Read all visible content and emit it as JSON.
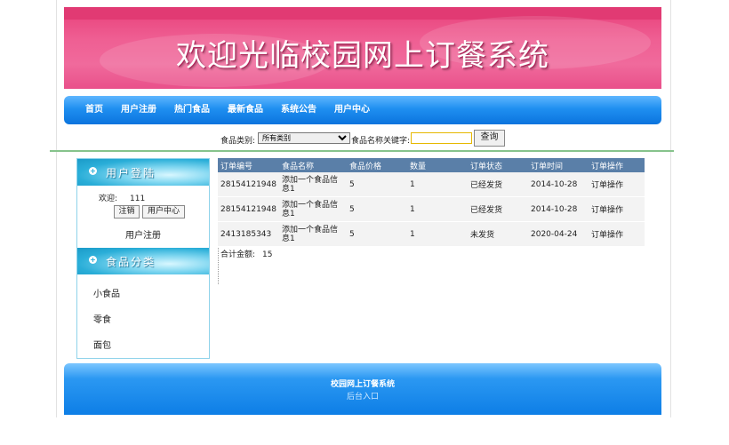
{
  "banner": {
    "title": "欢迎光临校园网上订餐系统"
  },
  "nav": {
    "items": [
      "首页",
      "用户注册",
      "热门食品",
      "最新食品",
      "系统公告",
      "用户中心"
    ]
  },
  "search": {
    "category_label": "食品类别:",
    "category_selected": "所有类别",
    "keyword_label": "食品名称关键字:",
    "keyword_value": "",
    "button_label": "查询"
  },
  "sidebar": {
    "login_title": "用户登陆",
    "welcome_label": "欢迎:",
    "welcome_user": "111",
    "logout_label": "注销",
    "user_center_label": "用户中心",
    "register_label": "用户注册",
    "category_title": "食品分类",
    "categories": [
      "小食品",
      "零食",
      "面包"
    ]
  },
  "orders": {
    "headers": [
      "订单编号",
      "食品名称",
      "食品价格",
      "数量",
      "订单状态",
      "订单时间",
      "订单操作"
    ],
    "rows": [
      [
        "28154121948",
        "添加一个食品信息1",
        "5",
        "1",
        "已经发货",
        "2014-10-28",
        "订单操作"
      ],
      [
        "28154121948",
        "添加一个食品信息1",
        "5",
        "1",
        "已经发货",
        "2014-10-28",
        "订单操作"
      ],
      [
        "2413185343",
        "添加一个食品信息1",
        "5",
        "1",
        "未发货",
        "2020-04-24",
        "订单操作"
      ]
    ],
    "total_label": "合计金额:",
    "total_value": "15"
  },
  "footer": {
    "title": "校园网上订餐系统",
    "admin_link": "后台入口"
  },
  "colors": {
    "banner": "#ef5f93",
    "nav": "#1f8ff0",
    "table_header": "#5a7fa8",
    "footer": "#0d7ee6"
  }
}
